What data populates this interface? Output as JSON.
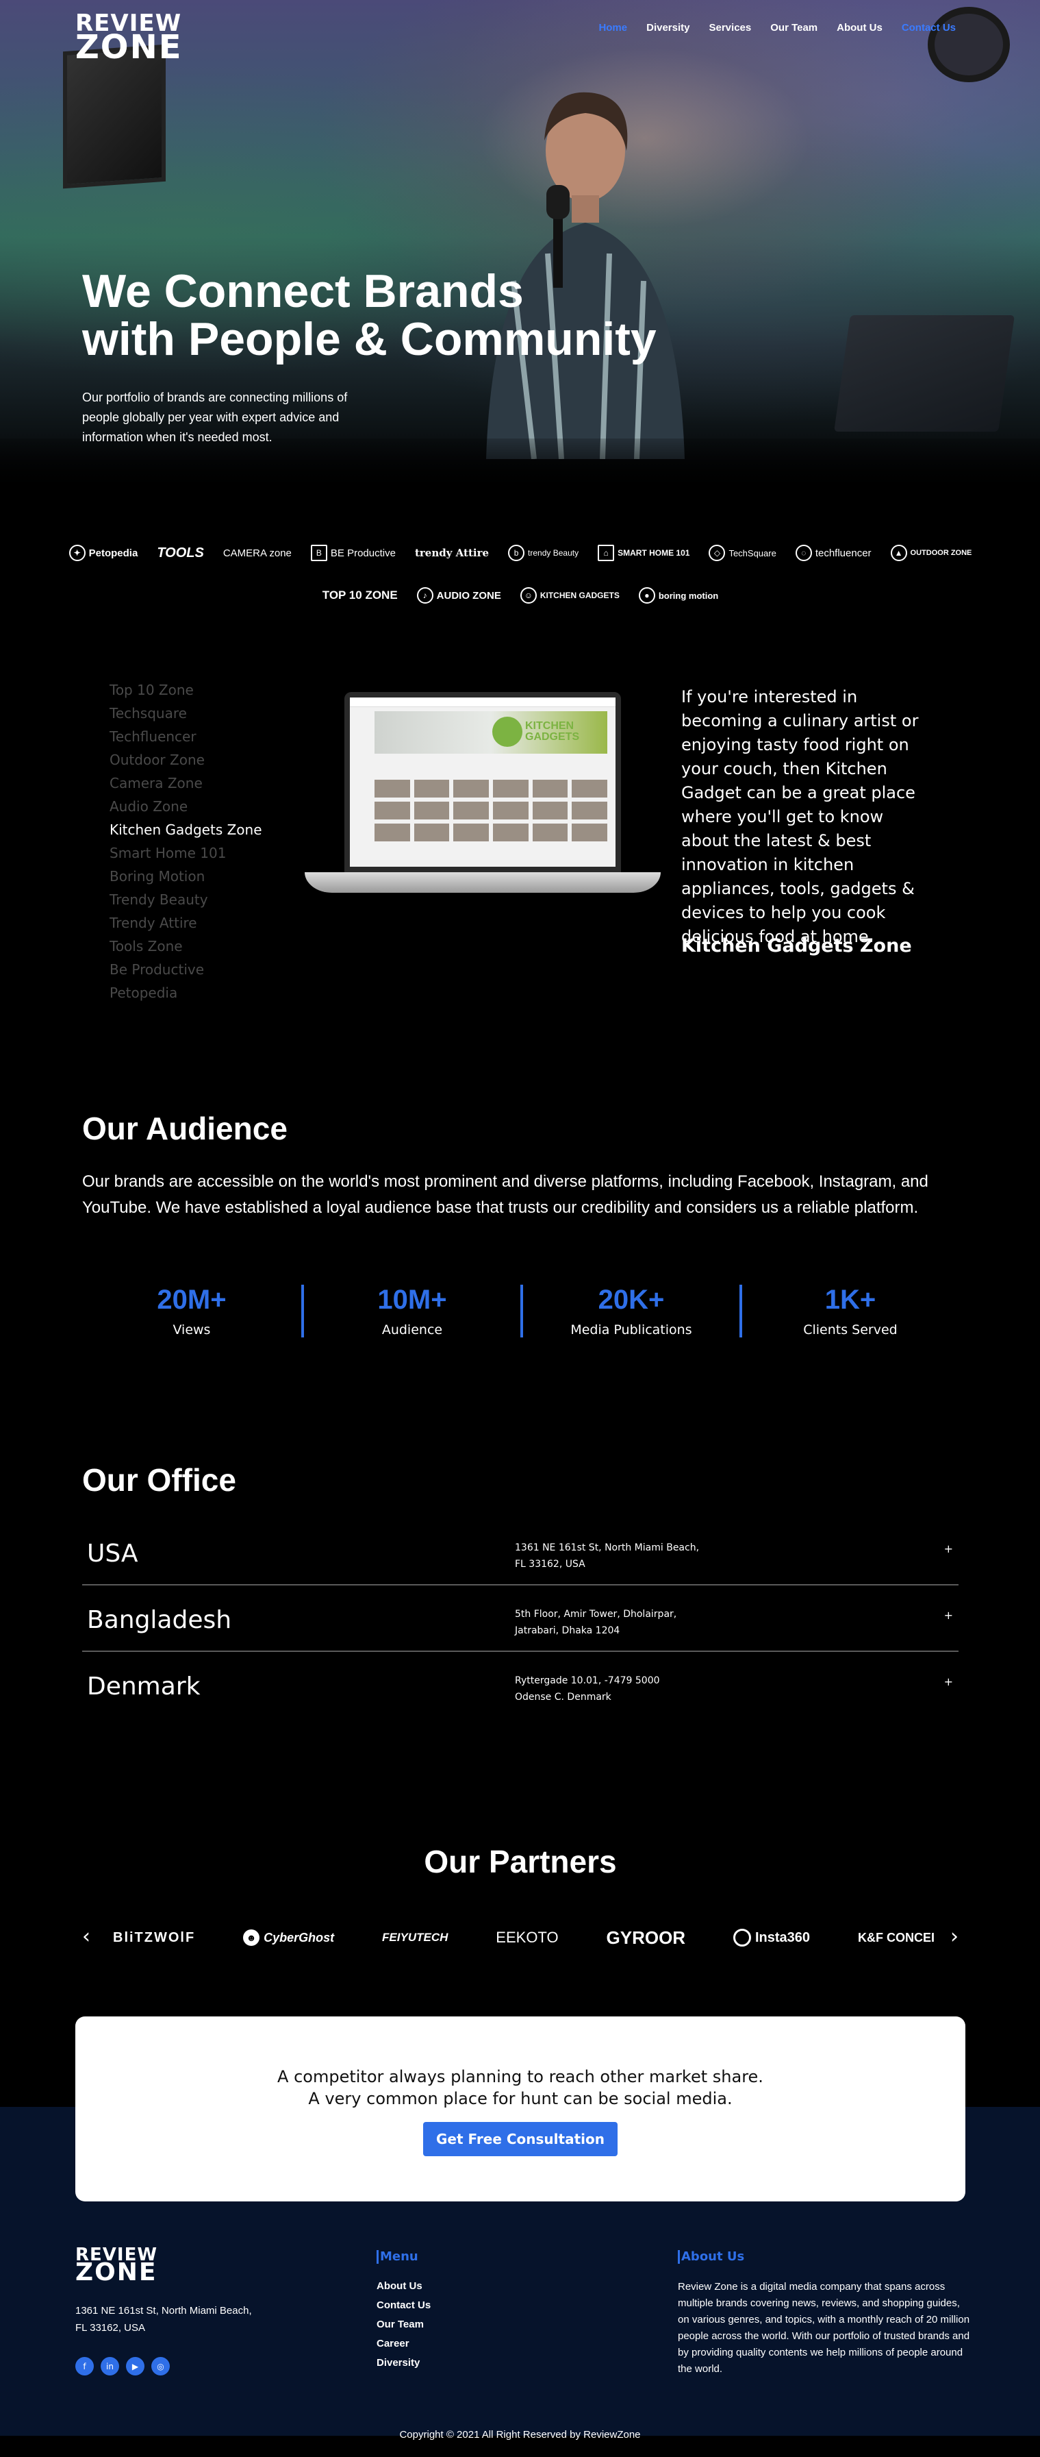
{
  "brand": {
    "logo_line1": "REVIEW",
    "logo_line2": "ZONE"
  },
  "nav": {
    "items": [
      "Home",
      "Diversity",
      "Services",
      "Our Team",
      "About Us",
      "Contact Us"
    ],
    "active": "Home"
  },
  "hero": {
    "title_line1": "We Connect Brands",
    "title_line2": "with People & Community",
    "body": "Our portfolio of brands are connecting millions of people globally per year with expert advice and  information when it's needed most."
  },
  "brand_logos": {
    "row1": [
      "Petopedia",
      "TOOLS",
      "CAMERA zone",
      "BE Productive",
      "trendy Attire",
      "trendy Beauty",
      "SMART HOME 101",
      "TechSquare",
      "techfluencer",
      "OUTDOOR ZONE"
    ],
    "row2": [
      "TOP 10 ZONE",
      "AUDIO ZONE",
      "KITCHEN GADGETS",
      "boring motion"
    ]
  },
  "zones": {
    "list": [
      "Top 10 Zone",
      "Techsquare",
      "Techfluencer",
      "Outdoor Zone",
      "Camera Zone",
      "Audio Zone",
      "Kitchen Gadgets Zone",
      "Smart Home 101",
      "Boring Motion",
      "Trendy Beauty",
      "Trendy Attire",
      "Tools Zone",
      "Be Productive",
      "Petopedia"
    ],
    "active_index": 6,
    "screen_title_line1": "KITCHEN",
    "screen_title_line2": "GADGETS",
    "description": "If you're interested in becoming a culinary artist or enjoying tasty food right on your couch, then Kitchen Gadget can be a great place where you'll get to know about the latest & best innovation in kitchen appliances, tools, gadgets & devices to help you cook delicious food at home.",
    "name": "Kitchen Gadgets Zone"
  },
  "audience": {
    "title": "Our Audience",
    "body": "Our brands are accessible on the world's most prominent and diverse platforms, including Facebook, Instagram, and YouTube. We have established a loyal audience base that trusts our credibility and considers us a reliable platform.",
    "stats": [
      {
        "value": "20M+",
        "label": "Views"
      },
      {
        "value": "10M+",
        "label": "Audience"
      },
      {
        "value": "20K+",
        "label": "Media Publications"
      },
      {
        "value": "1K+",
        "label": "Clients Served"
      }
    ]
  },
  "office": {
    "title": "Our Office",
    "rows": [
      {
        "country": "USA",
        "address_line1": "1361 NE 161st St, North Miami Beach,",
        "address_line2": "FL 33162, USA",
        "toggle": "+"
      },
      {
        "country": "Bangladesh",
        "address_line1": "5th Floor, Amir Tower, Dholairpar,",
        "address_line2": "Jatrabari, Dhaka 1204",
        "toggle": "+"
      },
      {
        "country": "Denmark",
        "address_line1": "Ryttergade 10.01, -7479 5000",
        "address_line2": "Odense C. Denmark",
        "toggle": "+"
      }
    ]
  },
  "partners": {
    "title": "Our Partners",
    "prev": "‹",
    "next": "›",
    "logos": [
      "BliTZWOlF",
      "CyberGhost",
      "FEIYUTECH",
      "EEKOTO",
      "GYROOR",
      "Insta360",
      "K&F CONCEI"
    ]
  },
  "cta": {
    "line1": "A competitor always planning to reach other market share.",
    "line2": "A very common place for hunt can be social media.",
    "button": "Get Free Consultation"
  },
  "footer": {
    "address_line1": "1361 NE 161st St, North Miami Beach,",
    "address_line2": "FL 33162, USA",
    "socials": [
      "facebook-icon",
      "linkedin-icon",
      "youtube-icon",
      "instagram-icon"
    ],
    "menu_title": "Menu",
    "menu_items": [
      "About Us",
      "Contact Us",
      "Our Team",
      "Career",
      "Diversity"
    ],
    "about_title": "About Us",
    "about_body": "Review Zone is a digital media company that spans across multiple brands covering news, reviews, and shopping guides, on various genres, and topics, with a monthly reach of 20 million people across the world. With our portfolio of trusted brands and by providing quality contents we help millions of people around the world.",
    "copyright": "Copyright © 2021 All Right Reserved by ReviewZone"
  },
  "colors": {
    "accent": "#2f6fe8",
    "nav_active": "#3a7bff",
    "footer_bg": "#06132b"
  }
}
